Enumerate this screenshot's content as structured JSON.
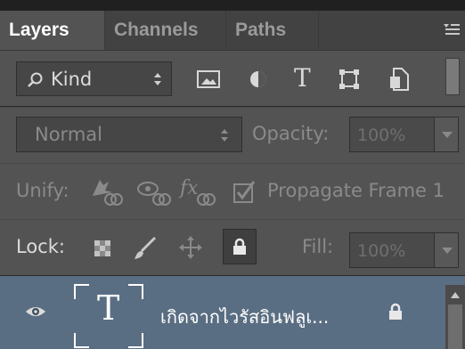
{
  "tabs": [
    "Layers",
    "Channels",
    "Paths"
  ],
  "filter": {
    "kind_label": "Kind",
    "icons": [
      "image-filter-icon",
      "adjustment-filter-icon",
      "type-filter-icon",
      "shape-filter-icon",
      "smart-object-filter-icon"
    ]
  },
  "blend": {
    "mode": "Normal",
    "opacity_label": "Opacity:",
    "opacity_value": "100%"
  },
  "unify": {
    "label": "Unify:",
    "propagate_label": "Propagate Frame 1"
  },
  "lock": {
    "label": "Lock:",
    "fill_label": "Fill:",
    "fill_value": "100%"
  },
  "layer": {
    "name": "เกิดจากไวรัสอินฟลูเ...",
    "thumb_letter": "T"
  },
  "colors": {
    "panel": "#535353",
    "tabbar": "#424242",
    "selected_layer": "#5a6e83"
  }
}
